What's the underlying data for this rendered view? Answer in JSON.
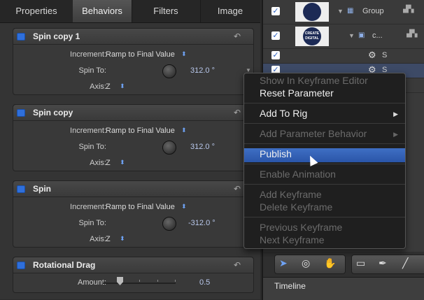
{
  "tabs": [
    "Properties",
    "Behaviors",
    "Filters",
    "Image"
  ],
  "behaviors": [
    {
      "title": "Spin copy 1",
      "rows": [
        {
          "label": "Increment:",
          "value": "Ramp to Final Value"
        },
        {
          "label": "Spin To:",
          "value": "312.0 °"
        },
        {
          "label": "Axis:",
          "value": "Z"
        }
      ]
    },
    {
      "title": "Spin copy",
      "rows": [
        {
          "label": "Increment:",
          "value": "Ramp to Final Value"
        },
        {
          "label": "Spin To:",
          "value": "312.0 °"
        },
        {
          "label": "Axis:",
          "value": "Z"
        }
      ]
    },
    {
      "title": "Spin",
      "rows": [
        {
          "label": "Increment:",
          "value": "Ramp to Final Value"
        },
        {
          "label": "Spin To:",
          "value": "-312.0 °"
        },
        {
          "label": "Axis:",
          "value": "Z"
        }
      ]
    },
    {
      "title": "Rotational Drag",
      "rows": [
        {
          "label": "Amount:",
          "value": "0.5"
        }
      ]
    }
  ],
  "layers": {
    "group_label": "Group",
    "clip_label": "c...",
    "badge_text": "CREATE DIGITAL",
    "behavior_letter": "S"
  },
  "menu": {
    "items": [
      {
        "label": "Show In Keyframe Editor",
        "disabled": true
      },
      {
        "label": "Reset Parameter",
        "disabled": false
      },
      {
        "label": "Add To Rig",
        "disabled": false,
        "submenu": true
      },
      {
        "label": "Add Parameter Behavior",
        "disabled": true,
        "submenu": true
      },
      {
        "label": "Publish",
        "disabled": false,
        "highlighted": true
      },
      {
        "label": "Enable Animation",
        "disabled": true
      },
      {
        "label": "Add Keyframe",
        "disabled": true
      },
      {
        "label": "Delete Keyframe",
        "disabled": true
      },
      {
        "label": "Previous Keyframe",
        "disabled": true
      },
      {
        "label": "Next Keyframe",
        "disabled": true
      }
    ]
  },
  "timeline": {
    "label": "Timeline"
  },
  "colors": {
    "accent": "#2f6fdb",
    "menu_highlight": "#3465b8"
  },
  "icons": {
    "reset": "reset-arrow-icon",
    "gear": "gear-icon",
    "check": "checkmark-icon"
  }
}
